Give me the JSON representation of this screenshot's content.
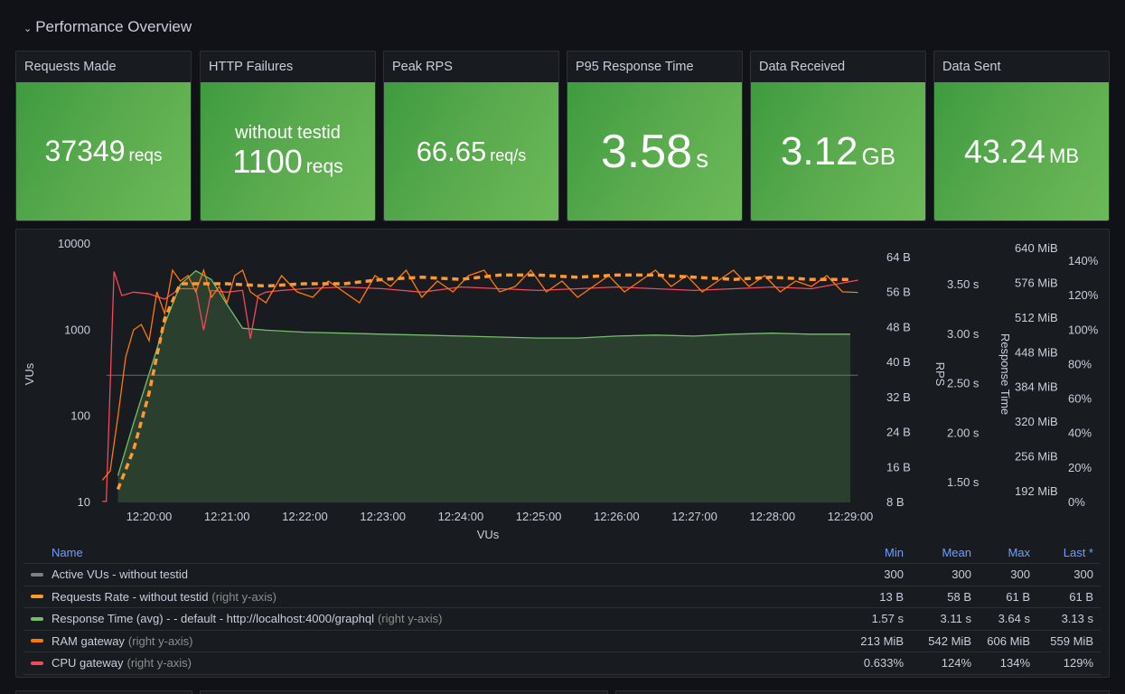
{
  "row": {
    "title": "Performance Overview",
    "chevron": "chevron-down-icon"
  },
  "stats": [
    {
      "title": "Requests Made",
      "subtitle": "",
      "value": "37349",
      "unit": "reqs"
    },
    {
      "title": "HTTP Failures",
      "subtitle": "without testid",
      "value": "1100",
      "unit": "reqs"
    },
    {
      "title": "Peak RPS",
      "subtitle": "",
      "value": "66.65",
      "unit": "req/s"
    },
    {
      "title": "P95 Response Time",
      "subtitle": "",
      "value": "3.58",
      "unit": "s"
    },
    {
      "title": "Data Received",
      "subtitle": "",
      "value": "3.12",
      "unit": "GB"
    },
    {
      "title": "Data Sent",
      "subtitle": "",
      "value": "43.24",
      "unit": "MB"
    }
  ],
  "colors": {
    "stat_green": "#56a64b",
    "active_vus": "#808080",
    "requests_rate": "#ff9830",
    "response_time": "#73bf69",
    "ram": "#ff780a",
    "cpu": "#f2495c",
    "header_blue": "#6e9fff"
  },
  "chart_data": {
    "type": "line",
    "title": "",
    "xlabel": "VUs",
    "x_ticks": [
      "12:20:00",
      "12:21:00",
      "12:22:00",
      "12:23:00",
      "12:24:00",
      "12:25:00",
      "12:26:00",
      "12:27:00",
      "12:28:00",
      "12:29:00"
    ],
    "axes": {
      "left": {
        "label": "VUs",
        "scale": "log",
        "ticks": [
          "10",
          "100",
          "1000",
          "10000"
        ],
        "range": [
          10,
          10000
        ]
      },
      "right1": {
        "label": "",
        "ticks": [
          "8 B",
          "16 B",
          "24 B",
          "32 B",
          "40 B",
          "48 B",
          "56 B",
          "64 B"
        ],
        "range": [
          8,
          64
        ]
      },
      "right2": {
        "label": "RPS",
        "ticks": [
          "1.50 s",
          "2.00 s",
          "2.50 s",
          "3.00 s",
          "3.50 s"
        ],
        "range": [
          1.25,
          3.7
        ]
      },
      "right3": {
        "label": "Response Time",
        "ticks": [
          "192 MiB",
          "256 MiB",
          "320 MiB",
          "384 MiB",
          "448 MiB",
          "512 MiB",
          "576 MiB",
          "640 MiB"
        ],
        "range": [
          192,
          640
        ]
      },
      "right4": {
        "label": "",
        "ticks": [
          "0%",
          "20%",
          "40%",
          "60%",
          "80%",
          "100%",
          "120%",
          "140%"
        ],
        "range": [
          0,
          140
        ]
      }
    },
    "x_range_minutes": [
      -0.55,
      9.1
    ],
    "series": [
      {
        "name": "Active VUs - without testid",
        "axis": "left",
        "style": "solid",
        "color": "#808080",
        "x": [
          -0.55,
          9.1
        ],
        "values": [
          300,
          300
        ]
      },
      {
        "name": "Requests Rate - without testid",
        "axis": "right1",
        "style": "dashed",
        "color": "#ff9830",
        "x": [
          -0.4,
          -0.2,
          0.0,
          0.2,
          0.4,
          0.6,
          0.8,
          1.0,
          1.5,
          2.0,
          2.5,
          3.0,
          3.5,
          4.0,
          4.5,
          5.0,
          5.5,
          6.0,
          6.5,
          7.0,
          7.5,
          8.0,
          8.5,
          9.0
        ],
        "values": [
          11,
          20,
          33,
          50,
          58,
          58,
          58,
          58,
          57.5,
          58,
          58,
          59,
          59.5,
          59,
          60,
          60,
          59.5,
          60,
          60,
          59.5,
          59,
          59.5,
          59,
          59
        ]
      },
      {
        "name": "Response Time (avg) - - default - http://localhost:4000/graphql",
        "axis": "right2",
        "style": "area",
        "color": "#73bf69",
        "x": [
          -0.4,
          -0.2,
          0.0,
          0.2,
          0.4,
          0.6,
          0.8,
          1.0,
          1.2,
          1.5,
          2.0,
          2.5,
          3.0,
          3.5,
          4.0,
          4.5,
          5.0,
          5.5,
          6.0,
          6.5,
          7.0,
          7.5,
          8.0,
          8.5,
          9.0
        ],
        "values": [
          1.57,
          2.1,
          2.6,
          3.1,
          3.5,
          3.64,
          3.55,
          3.3,
          3.06,
          3.04,
          3.02,
          3.01,
          3.0,
          2.99,
          2.98,
          2.97,
          2.96,
          2.96,
          2.98,
          2.99,
          2.98,
          3.0,
          3.01,
          3.0,
          3.0
        ]
      },
      {
        "name": "RAM gateway",
        "axis": "right3",
        "style": "solid",
        "color": "#ff780a",
        "x": [
          -0.6,
          -0.5,
          -0.4,
          -0.3,
          -0.2,
          -0.1,
          0.0,
          0.1,
          0.2,
          0.3,
          0.4,
          0.5,
          0.6,
          0.7,
          0.8,
          0.9,
          1.0,
          1.1,
          1.2,
          1.3,
          1.5,
          1.7,
          1.9,
          2.1,
          2.3,
          2.5,
          2.7,
          2.9,
          3.1,
          3.3,
          3.5,
          3.7,
          3.9,
          4.1,
          4.3,
          4.5,
          4.7,
          4.9,
          5.1,
          5.3,
          5.5,
          5.7,
          5.9,
          6.1,
          6.3,
          6.5,
          6.7,
          6.9,
          7.1,
          7.3,
          7.5,
          7.7,
          7.9,
          8.1,
          8.3,
          8.5,
          8.7,
          8.9,
          9.1
        ],
        "values": [
          213,
          230,
          330,
          440,
          490,
          500,
          470,
          560,
          520,
          600,
          580,
          590,
          560,
          600,
          550,
          570,
          540,
          590,
          600,
          560,
          540,
          590,
          560,
          550,
          580,
          560,
          540,
          590,
          570,
          600,
          550,
          580,
          560,
          590,
          600,
          560,
          570,
          600,
          560,
          580,
          550,
          570,
          590,
          560,
          580,
          600,
          570,
          590,
          560,
          580,
          600,
          570,
          590,
          560,
          580,
          570,
          590,
          560,
          559
        ]
      },
      {
        "name": "CPU gateway",
        "axis": "right4",
        "style": "solid",
        "color": "#f2495c",
        "x": [
          -0.6,
          -0.55,
          -0.45,
          -0.35,
          -0.2,
          0.0,
          0.2,
          0.4,
          0.6,
          0.7,
          0.8,
          1.0,
          1.2,
          1.3,
          1.4,
          1.5,
          1.7,
          2.0,
          2.5,
          3.0,
          3.5,
          4.0,
          4.5,
          5.0,
          5.5,
          6.0,
          6.5,
          7.0,
          7.5,
          8.0,
          8.5,
          9.1
        ],
        "values": [
          0.633,
          0.6,
          134,
          120,
          122,
          121,
          118,
          124,
          124,
          100,
          123,
          122,
          123,
          95,
          120,
          122,
          123,
          124,
          125,
          124,
          122,
          125,
          124,
          123,
          124,
          125,
          124,
          123,
          124,
          125,
          124,
          129
        ]
      }
    ]
  },
  "legend": {
    "headers": {
      "name": "Name",
      "min": "Min",
      "mean": "Mean",
      "max": "Max",
      "last": "Last *"
    },
    "rows": [
      {
        "name": "Active VUs - without testid",
        "axis_note": "",
        "color": "#808080",
        "min": "300",
        "mean": "300",
        "max": "300",
        "last": "300"
      },
      {
        "name": "Requests Rate - without testid",
        "axis_note": "(right y-axis)",
        "color": "#ff9830",
        "min": "13 B",
        "mean": "58 B",
        "max": "61 B",
        "last": "61 B"
      },
      {
        "name": "Response Time (avg) - - default - http://localhost:4000/graphql",
        "axis_note": "(right y-axis)",
        "color": "#73bf69",
        "min": "1.57 s",
        "mean": "3.11 s",
        "max": "3.64 s",
        "last": "3.13 s"
      },
      {
        "name": "RAM gateway",
        "axis_note": "(right y-axis)",
        "color": "#ff780a",
        "min": "213 MiB",
        "mean": "542 MiB",
        "max": "606 MiB",
        "last": "559 MiB"
      },
      {
        "name": "CPU gateway",
        "axis_note": "(right y-axis)",
        "color": "#f2495c",
        "min": "0.633%",
        "mean": "124%",
        "max": "134%",
        "last": "129%"
      }
    ]
  }
}
